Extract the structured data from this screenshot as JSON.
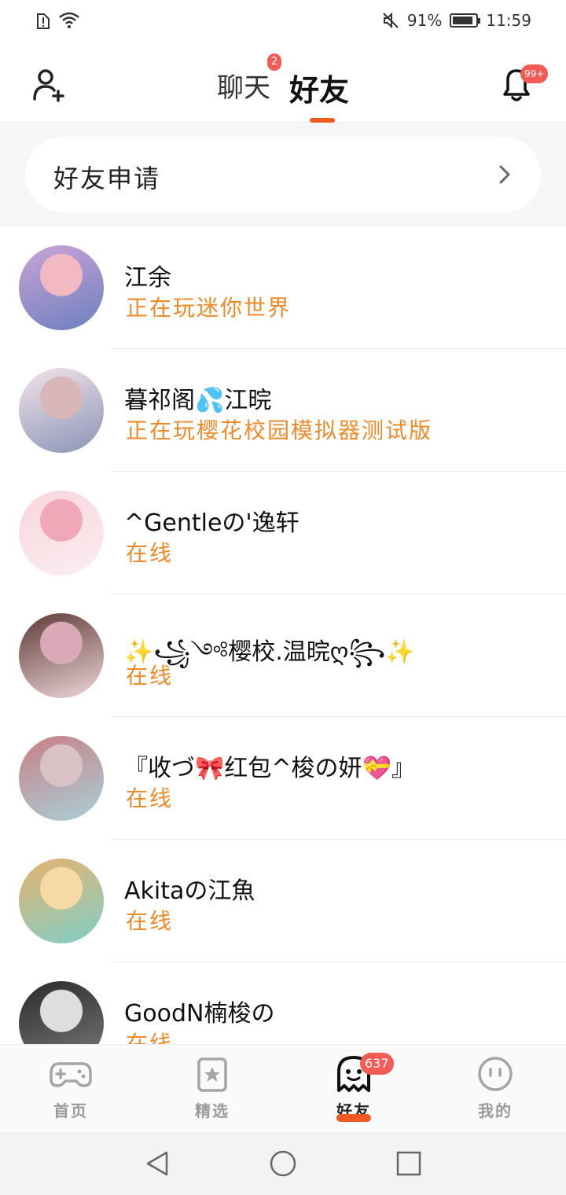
{
  "status_bar": {
    "battery_percent": "91%",
    "battery_level": 0.91,
    "time": "11:59"
  },
  "header": {
    "tabs": [
      {
        "label": "聊天",
        "badge": "2",
        "active": false
      },
      {
        "label": "好友",
        "badge": "",
        "active": true
      }
    ],
    "notifications_badge": "99+"
  },
  "friend_requests": {
    "label": "好友申请"
  },
  "friends": [
    {
      "name": "江余",
      "status": "正在玩迷你世界",
      "avatar_colors": [
        "#c9a4d6",
        "#f2b9c3",
        "#6d7fbf"
      ]
    },
    {
      "name": "暮祁阁💦江晥",
      "status": "正在玩樱花校园模拟器测试版",
      "avatar_colors": [
        "#f3e4e8",
        "#d9b7b9",
        "#8a94b8"
      ]
    },
    {
      "name": "^Gentleの'逸轩",
      "status": "在线",
      "avatar_colors": [
        "#f7d5dc",
        "#f0a7b8",
        "#fbeef1"
      ]
    },
    {
      "name": "✨꧁༺樱校.温晥ღ꧂✨",
      "status": "在线",
      "avatar_colors": [
        "#5c3a36",
        "#d9a9b7",
        "#f0d6d9"
      ]
    },
    {
      "name": "『收づ🎀红包^梭の妍💝』",
      "status": "在线",
      "avatar_colors": [
        "#c97f86",
        "#d9c2c6",
        "#a9d0d8"
      ]
    },
    {
      "name": "Akitaの江魚",
      "status": "在线",
      "avatar_colors": [
        "#e7b26e",
        "#f6d9a4",
        "#7fcfc6"
      ]
    },
    {
      "name": "GoodN楠梭の",
      "status": "在线",
      "avatar_colors": [
        "#2a2a2a",
        "#dedede",
        "#7a7a7a"
      ]
    }
  ],
  "bottom_nav": {
    "items": [
      {
        "label": "首页",
        "icon": "gamepad-icon",
        "active": false
      },
      {
        "label": "精选",
        "icon": "star-bookmark-icon",
        "active": false
      },
      {
        "label": "好友",
        "icon": "ghost-icon",
        "active": true,
        "badge": "637"
      },
      {
        "label": "我的",
        "icon": "smiley-icon",
        "active": false
      }
    ]
  },
  "colors": {
    "accent": "#f15a22",
    "status_text": "#f08a28",
    "badge": "#f25c54"
  }
}
